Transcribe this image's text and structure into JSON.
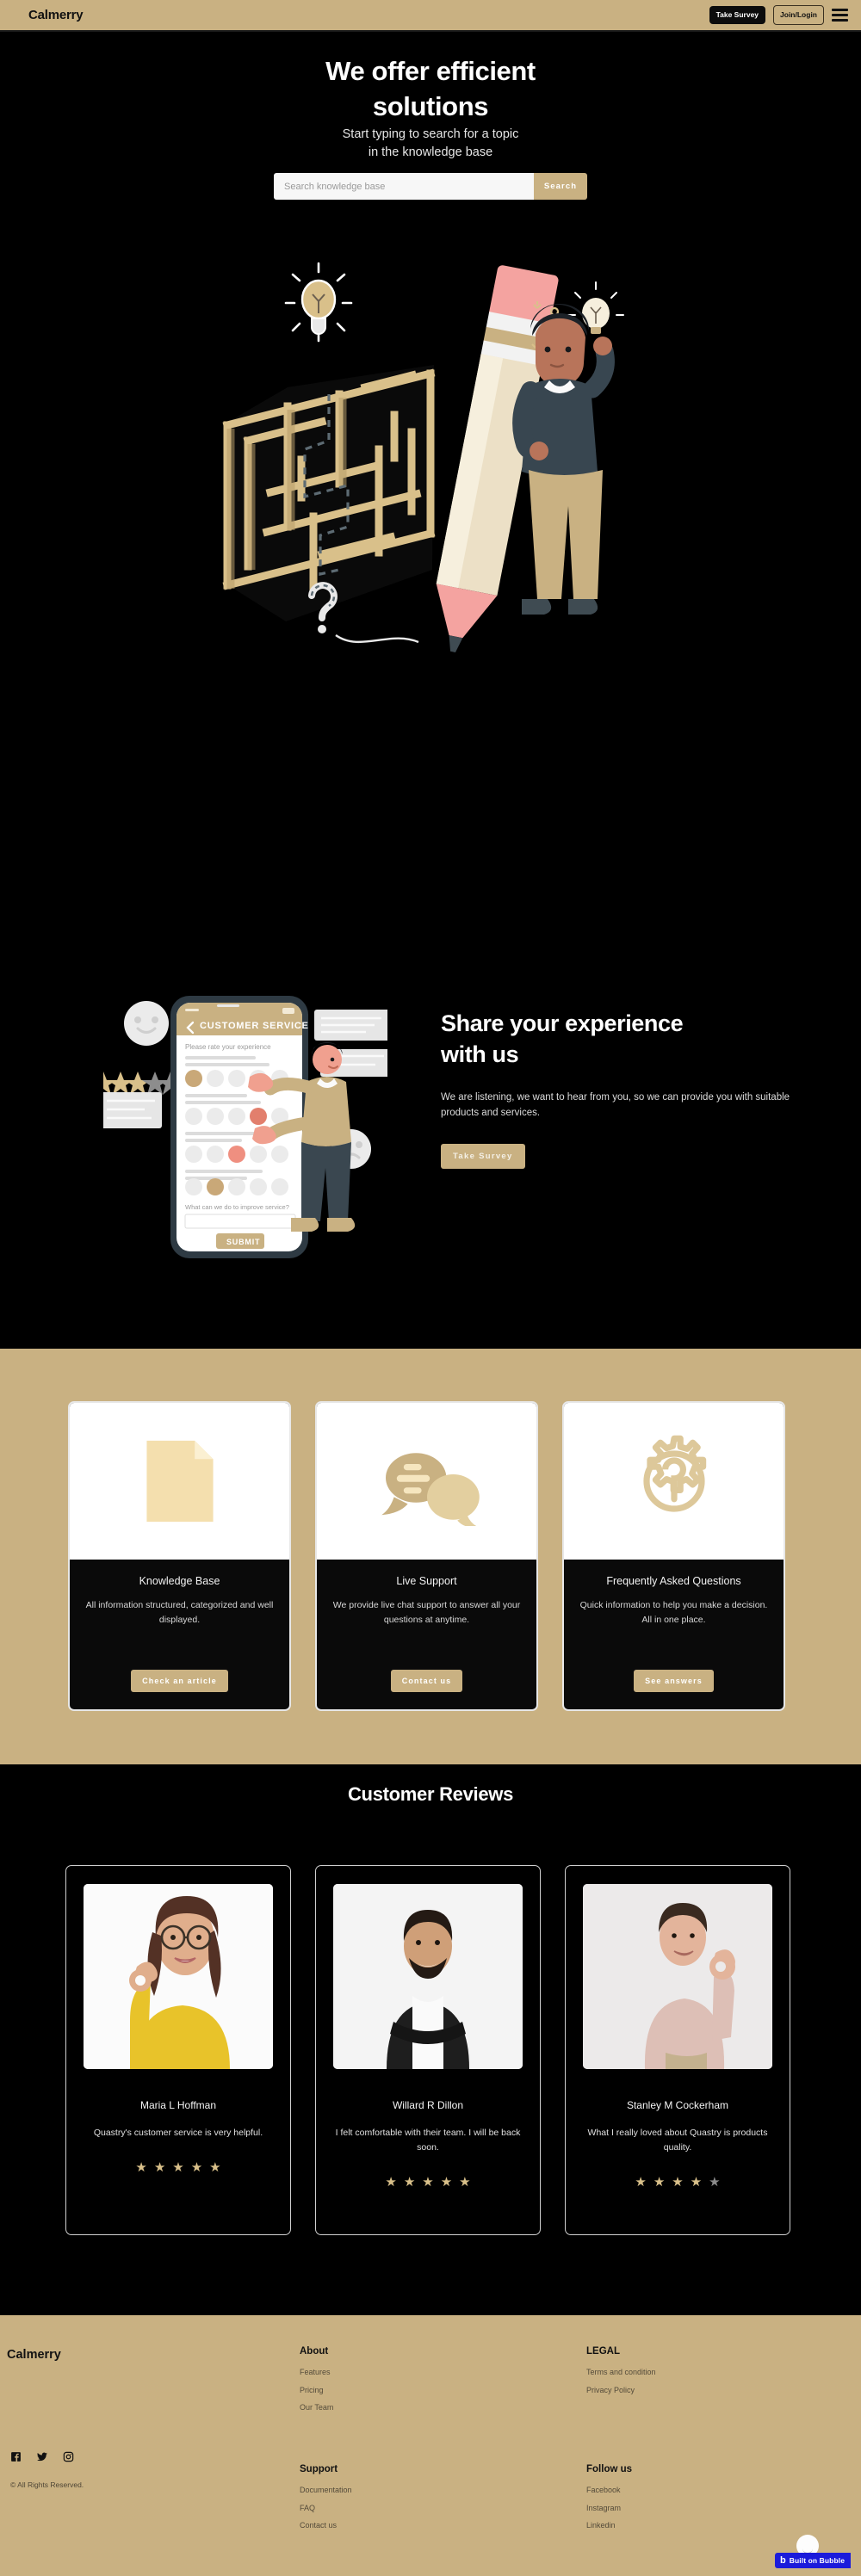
{
  "header": {
    "brand": "Calmerry",
    "take_survey_label": "Take Survey",
    "join_login_label": "Join/Login",
    "menu_icon": "hamburger-icon"
  },
  "hero": {
    "title_line1": "We offer efficient",
    "title_line2": "solutions",
    "subtitle_line1": "Start typing to search for a topic",
    "subtitle_line2": "in the knowledge base",
    "search_placeholder": "Search knowledge base",
    "search_value": "",
    "search_button": "Search",
    "illustration": "maze-pencil-person-illustration"
  },
  "share": {
    "title_line1": "Share your experience",
    "title_line2": "with us",
    "body": "We are listening, we want to hear from you, so we can provide you with suitable products and services.",
    "button": "Take Survey",
    "illustration": "customer-service-survey-phone-illustration",
    "phone": {
      "app_title": "CUSTOMER SERVICE",
      "prompt": "Please rate your experience",
      "question": "What can we do to improve service?",
      "submit": "SUBMIT"
    }
  },
  "features": {
    "cards": [
      {
        "icon": "document-icon",
        "title": "Knowledge Base",
        "desc": "All information structured, categorized and well displayed.",
        "button": "Check an article"
      },
      {
        "icon": "chat-bubbles-icon",
        "title": "Live Support",
        "desc": "We provide live chat support to answer all your questions at anytime.",
        "button": "Contact us"
      },
      {
        "icon": "gear-question-icon",
        "title": "Frequently Asked Questions",
        "desc": "Quick information to help you make a decision. All in one place.",
        "button": "See answers"
      }
    ]
  },
  "reviews": {
    "title": "Customer Reviews",
    "items": [
      {
        "photo": "woman-yellow-sweater-ok-gesture-photo",
        "name": "Maria L Hoffman",
        "text": "Quastry's customer service is very helpful.",
        "rating": 5
      },
      {
        "photo": "man-black-shirt-arms-crossed-photo",
        "name": "Willard R Dillon",
        "text": "I felt comfortable with their team. I will be back soon.",
        "rating": 5
      },
      {
        "photo": "man-pink-sweater-ok-gesture-photo",
        "name": "Stanley M Cockerham",
        "text": "What I really loved about Quastry is products quality.",
        "rating": 4
      }
    ],
    "max_rating": 5
  },
  "footer": {
    "brand": "Calmerry",
    "copyright": "© All Rights Reserved.",
    "social_icons": [
      "facebook-icon",
      "twitter-icon",
      "instagram-icon"
    ],
    "columns": [
      {
        "heading": "About",
        "links": [
          "Features",
          "Pricing",
          "Our Team"
        ]
      },
      {
        "heading": "Support",
        "links": [
          "Documentation",
          "FAQ",
          "Contact us"
        ]
      },
      {
        "heading": "LEGAL",
        "links": [
          "Terms and condition",
          "Privacy Policy"
        ]
      },
      {
        "heading": "Follow us",
        "links": [
          "Facebook",
          "Instagram",
          "Linkedin"
        ]
      }
    ]
  },
  "bubble_badge": {
    "logo": "b",
    "text": "Built on Bubble"
  },
  "colors": {
    "accent": "#c9b182",
    "dark": "#000000",
    "badge_blue": "#1b1bdb",
    "star_gold": "#d9c08a",
    "star_off": "#8c8c8c"
  }
}
